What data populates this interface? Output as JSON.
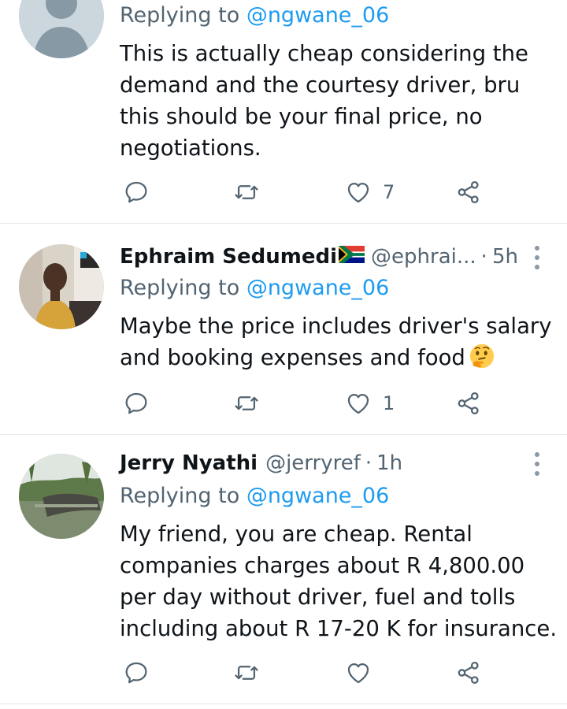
{
  "tweets": [
    {
      "replying_prefix": "Replying to ",
      "replying_to": "@ngwane_06",
      "text": "This is actually cheap considering the demand and the courtesy driver, bru this should be your final price, no negotiations.",
      "actions": {
        "reply_icon": "reply-icon",
        "retweet_icon": "retweet-icon",
        "like_icon": "heart-icon",
        "likes": "7",
        "share_icon": "share-icon"
      }
    },
    {
      "name": "Ephraim Sedumedi",
      "flag": "south-africa-flag",
      "handle": "@ephrai...",
      "separator": "·",
      "time": "5h",
      "replying_prefix": "Replying to ",
      "replying_to": "@ngwane_06",
      "text": "Maybe the price includes driver's salary and booking expenses and food",
      "emoji": "thinking-face",
      "actions": {
        "likes": "1"
      }
    },
    {
      "name": "Jerry Nyathi",
      "handle": "@jerryref",
      "separator": "·",
      "time": "1h",
      "replying_prefix": "Replying to ",
      "replying_to": "@ngwane_06",
      "text": "My friend, you are cheap. Rental companies charges about R 4,800.00 per day without driver, fuel and tolls including about R 17-20 K for insurance.",
      "actions": {
        "likes": ""
      }
    }
  ],
  "colors": {
    "secondary_text": "#536471",
    "link": "#1d9bf0",
    "divider": "#e7e9ea",
    "primary_text": "#0f1419"
  }
}
